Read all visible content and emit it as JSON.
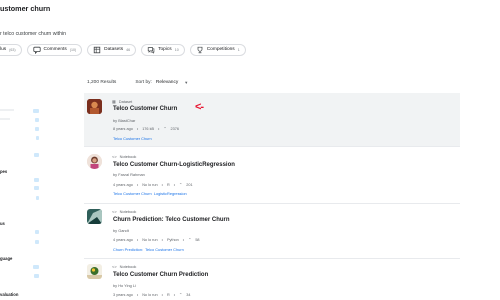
{
  "page": {
    "title": "ustomer churn",
    "search_label": "r telco customer churn within"
  },
  "filters": [
    {
      "label": "lus",
      "count": "(63)"
    },
    {
      "label": "Comments",
      "count": "(10)"
    },
    {
      "label": "Datasets",
      "count": "46"
    },
    {
      "label": "Topics",
      "count": "10"
    },
    {
      "label": "Competitions",
      "count": "1"
    }
  ],
  "results_bar": {
    "count": "1,200 Results",
    "sort_label": "Sort by:",
    "sort_value": "Relevancy"
  },
  "sidebar": {
    "labels": [
      "pes",
      "us",
      "guage",
      "valuation"
    ]
  },
  "results": [
    {
      "type": "Dataset",
      "title": "Telco Customer Churn",
      "author": "by BlastChar",
      "meta": [
        "8 years ago",
        "176 kB",
        "2376"
      ],
      "tags": [
        "Telco Customer Churn"
      ],
      "highlight": true
    },
    {
      "type": "Notebook",
      "title": "Telco Customer Churn-LogisticRegression",
      "author": "by Farzal Rahman",
      "meta": [
        "4 years ago",
        "No lo run",
        "R",
        "201"
      ],
      "tags": [
        "Telco Customer Churn",
        "LogisticRegression"
      ],
      "highlight": false
    },
    {
      "type": "Notebook",
      "title": "Churn Prediction: Telco Customer Churn",
      "author": "by Gandt",
      "meta": [
        "4 years ago",
        "No lo run",
        "Python",
        "58"
      ],
      "tags": [
        "Churn Prediction:",
        "Telco Customer Churn"
      ],
      "highlight": false
    },
    {
      "type": "Notebook",
      "title": "Telco Customer Churn Prediction",
      "author": "by Ho Ying Li",
      "meta": [
        "3 years ago",
        "No lo run",
        "R",
        "34"
      ],
      "tags": [],
      "highlight": false
    }
  ],
  "annotation": {
    "arrow": "<-"
  },
  "colors": {
    "accent": "#1a73e8",
    "arrow": "#e8132f",
    "badge": "#cfe8fb"
  }
}
